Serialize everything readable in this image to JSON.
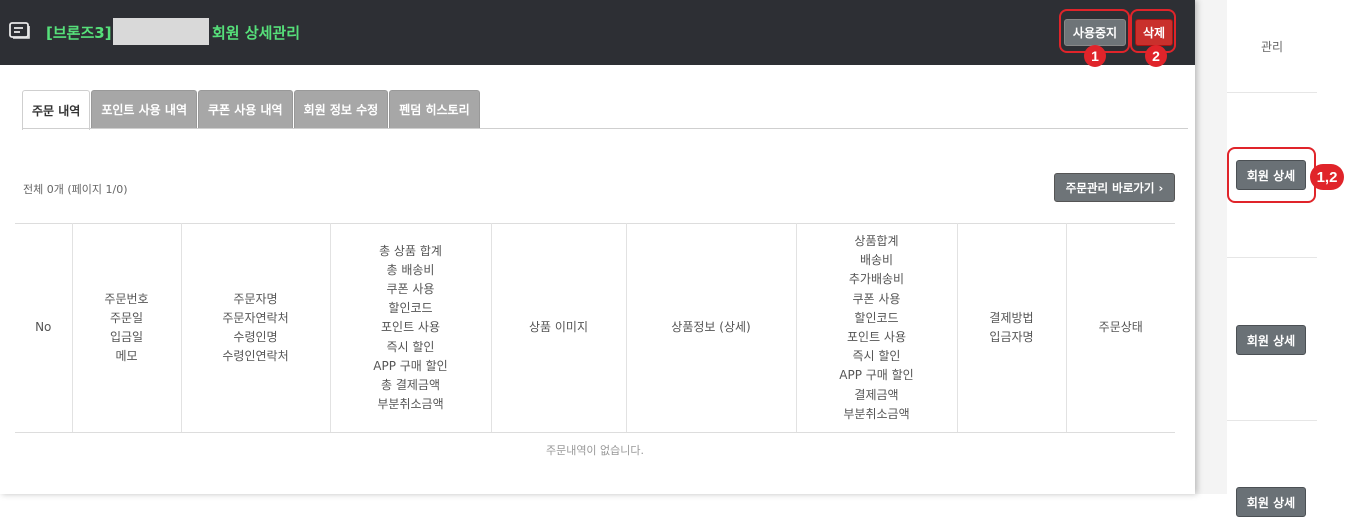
{
  "background_list": {
    "column_header": "관리",
    "row_buttons": [
      "회원 상세",
      "회원 상세",
      "회원 상세"
    ]
  },
  "modal": {
    "title_prefix": "[브론즈3]",
    "title_suffix": "회원 상세관리",
    "buttons": {
      "suspend": "사용중지",
      "delete": "삭제"
    },
    "annotations": {
      "suspend_badge": "1",
      "delete_badge": "2",
      "member_detail_badge": "1,2"
    },
    "tabs": [
      {
        "label": "주문 내역",
        "active": true
      },
      {
        "label": "포인트 사용 내역",
        "active": false
      },
      {
        "label": "쿠폰 사용 내역",
        "active": false
      },
      {
        "label": "회원 정보 수정",
        "active": false
      },
      {
        "label": "펜덤 히스토리",
        "active": false
      }
    ],
    "summary": "전체 0개 (페이지 1/0)",
    "goto_order_button": "주문관리 바로가기 ›",
    "table": {
      "columns": [
        [
          "No"
        ],
        [
          "주문번호",
          "주문일",
          "입금일",
          "메모"
        ],
        [
          "주문자명",
          "주문자연락처",
          "수령인명",
          "수령인연락처"
        ],
        [
          "총 상품 합계",
          "총 배송비",
          "쿠폰 사용",
          "할인코드",
          "포인트 사용",
          "즉시 할인",
          "APP 구매 할인",
          "총 결제금액",
          "부분취소금액"
        ],
        [
          "상품 이미지"
        ],
        [
          "상품정보 (상세)"
        ],
        [
          "상품합계",
          "배송비",
          "추가배송비",
          "쿠폰 사용",
          "할인코드",
          "포인트 사용",
          "즉시 할인",
          "APP 구매 할인",
          "결제금액",
          "부분취소금액"
        ],
        [
          "결제방법",
          "입금자명"
        ],
        [
          "주문상태"
        ]
      ],
      "empty_message": "주문내역이 없습니다."
    }
  },
  "colors": {
    "header_bg": "#2d2f34",
    "title_green": "#56e07a",
    "annotation_red": "#e0242a",
    "delete_red": "#c9302c"
  }
}
